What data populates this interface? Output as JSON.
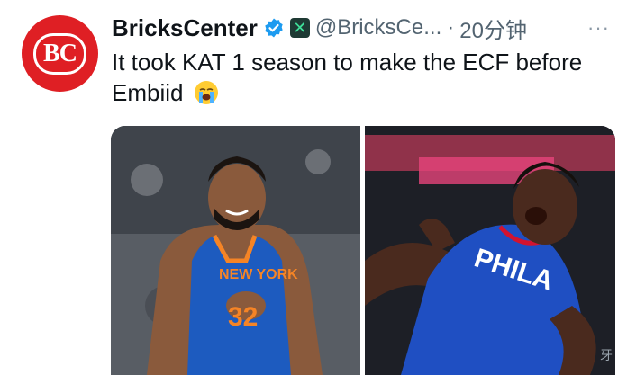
{
  "author": {
    "display_name": "BricksCenter",
    "avatar_monogram": "BC",
    "handle": "@BricksCe...",
    "separator": "·",
    "time": "20分钟",
    "badges": [
      "verified-icon",
      "x-brand-icon"
    ]
  },
  "menu": {
    "more_label": "···"
  },
  "tweet": {
    "text": "It took KAT 1 season to make the ECF before Embiid",
    "emoji": "loudly-crying-face-icon"
  },
  "media": {
    "left_photo": {
      "subject": "player-photo",
      "jersey_text": "NEW YORK",
      "jersey_number": "32"
    },
    "right_photo": {
      "subject": "player-photo",
      "jersey_text": "PHILA"
    }
  },
  "watermark": {
    "text": "牙"
  },
  "colors": {
    "avatar_red": "#df1f24",
    "verified_blue": "#1d9bf0",
    "text_primary": "#0f1419",
    "text_secondary": "#536471",
    "knicks_blue": "#1d5bbf",
    "knicks_orange": "#f58426",
    "sixers_blue": "#1f4fc2",
    "sixers_red": "#d3132f"
  }
}
